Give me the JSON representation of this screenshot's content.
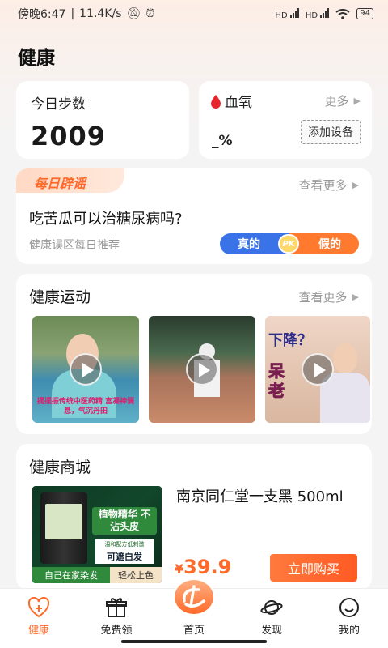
{
  "status_bar": {
    "time": "傍晚6:47",
    "speed": "11.4K/s",
    "network1": "HD",
    "network2": "HD",
    "battery": "94"
  },
  "page": {
    "title": "健康"
  },
  "steps": {
    "label": "今日步数",
    "value": "2009"
  },
  "oxygen": {
    "label": "血氧",
    "more": "更多",
    "value": "_%",
    "add_device": "添加设备"
  },
  "rumor": {
    "tag": "每日辟谣",
    "more": "查看更多",
    "question": "吃苦瓜可以治糖尿病吗?",
    "subtitle": "健康误区每日推荐",
    "true_label": "真的",
    "pk_label": "PK",
    "false_label": "假的"
  },
  "sport": {
    "title": "健康运动",
    "more": "查看更多",
    "videos": [
      {
        "caption": "提提振传统中医药精 宫凝神调息，气沉丹田"
      },
      {
        "caption": ""
      },
      {
        "caption_top": "下降？",
        "caption_mid": "呆\n老"
      }
    ]
  },
  "mall": {
    "title": "健康商城",
    "product_name": "南京同仁堂一支黑 500ml",
    "price_currency": "¥",
    "price_value": "39.9",
    "buy_label": "立即购买",
    "img_text1": "植物精华 不沾头皮",
    "img_text2": "温和配方低刺激",
    "img_text3": "可遮白发",
    "img_strip_a": "自己在家染发",
    "img_strip_b": "轻松上色"
  },
  "tabbar": {
    "items": [
      {
        "label": "健康",
        "icon": "health-plus-icon",
        "active": true
      },
      {
        "label": "免费领",
        "icon": "gift-icon",
        "active": false
      },
      {
        "label": "首页",
        "icon": "home-logo-icon",
        "active": false
      },
      {
        "label": "发现",
        "icon": "planet-icon",
        "active": false
      },
      {
        "label": "我的",
        "icon": "smile-face-icon",
        "active": false
      }
    ]
  },
  "colors": {
    "accent": "#ff6a2a",
    "blue": "#3a73e8"
  }
}
